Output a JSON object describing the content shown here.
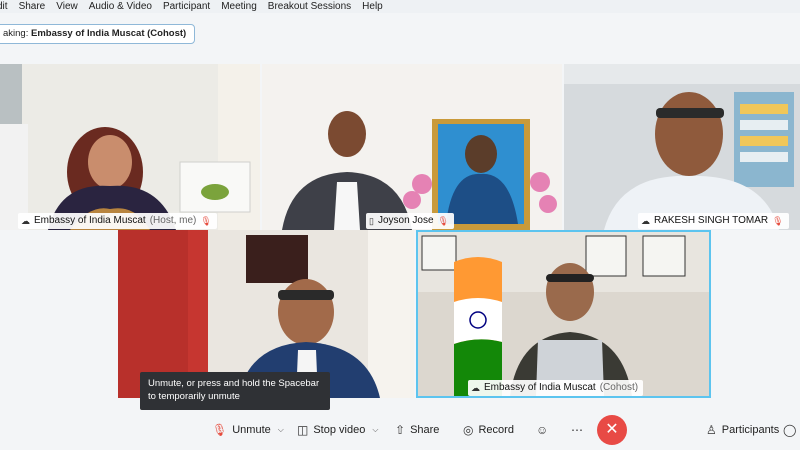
{
  "menu": [
    "dit",
    "Share",
    "View",
    "Audio & Video",
    "Participant",
    "Meeting",
    "Breakout Sessions",
    "Help"
  ],
  "speaking": {
    "prefix": "aking:",
    "name": "Embassy of India Muscat (Cohost)"
  },
  "tiles": [
    {
      "name": "Embassy of India Muscat",
      "role": "(Host, me)"
    },
    {
      "name": "Joyson Jose",
      "role": ""
    },
    {
      "name": "RAKESH SINGH TOMAR",
      "role": ""
    },
    {
      "name": "",
      "role": ""
    },
    {
      "name": "Embassy of India Muscat",
      "role": "(Cohost)"
    }
  ],
  "tooltip": "Unmute, or press and hold the Spacebar to temporarily unmute",
  "toolbar": {
    "unmute": "Unmute",
    "stop_video": "Stop video",
    "share": "Share",
    "record": "Record",
    "participants": "Participants"
  },
  "icons": {
    "mic_muted": "mic-muted-icon",
    "camera": "camera-icon",
    "share": "share-icon",
    "record": "record-icon",
    "reactions": "smiley-icon",
    "more": "ellipsis-icon",
    "end": "close-icon",
    "participants": "person-icon",
    "chat": "chat-icon"
  },
  "colors": {
    "accent": "#5cc4ef",
    "end_call": "#e84a45",
    "mute_red": "#e64a3c"
  }
}
